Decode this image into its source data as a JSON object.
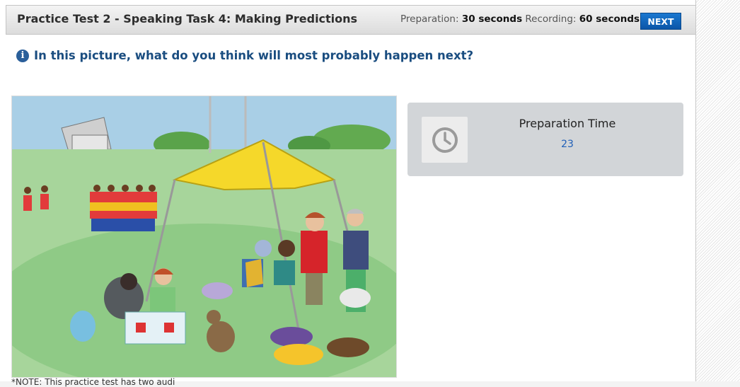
{
  "header": {
    "title": "Practice Test 2 - Speaking Task 4: Making Predictions",
    "prep_label": "Preparation:",
    "prep_value": "30 seconds",
    "rec_label": "Recording:",
    "rec_value": "60 seconds",
    "next_label": "NEXT"
  },
  "question": {
    "icon": "info-icon",
    "text": "In this picture, what do you think will most probably happen next?"
  },
  "picture": {
    "subject": "picnic-illustration"
  },
  "note": "*NOTE: This practice test has two audi",
  "timer": {
    "icon": "clock-icon",
    "label": "Preparation Time",
    "value": "23"
  },
  "colors": {
    "accent": "#0b56a8",
    "title_text": "#1a4d80",
    "timer_value": "#1f5fb8",
    "timer_box": "#d2d5d8"
  }
}
